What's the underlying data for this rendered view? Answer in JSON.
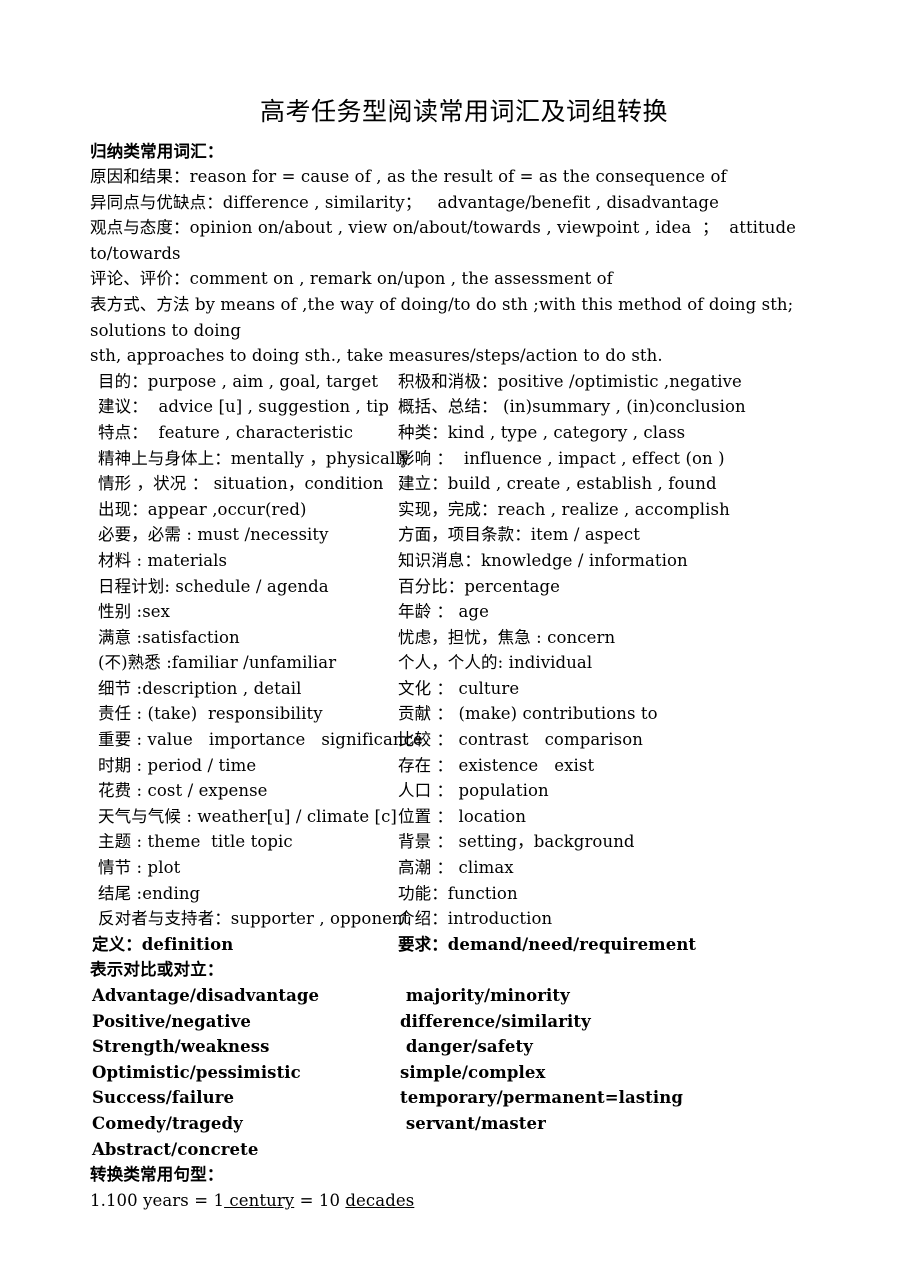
{
  "document": {
    "title": "高考任务型阅读常用词汇及词组转换",
    "section_1_heading": "归纳类常用词汇：",
    "full_lines": [
      "原因和结果：reason for = cause of , as the result of = as the consequence of",
      "异同点与优缺点：difference , similarity；   advantage/benefit , disadvantage",
      "观点与态度：opinion on/about , view on/about/towards , viewpoint , idea  ；  attitude to/towards",
      "评论、评价：comment on , remark on/upon , the assessment of"
    ],
    "method_line_part1": "表方式、方法 by means of ,the way of doing/to do sth ;with this method of doing sth; solutions to doing",
    "method_line_part2": "sth, approaches to doing sth., take measures/steps/action to do sth.",
    "vocab_rows": [
      {
        "left": "目的：purpose , aim , goal, target",
        "right": "积极和消极：positive /optimistic ,negative"
      },
      {
        "left": "建议：  advice [u] , suggestion , tip",
        "right": "概括、总结： (in)summary , (in)conclusion"
      },
      {
        "left": "特点：  feature , characteristic",
        "right": "种类：kind , type , category , class"
      },
      {
        "left": "精神上与身体上：mentally ，physically",
        "right": "影响 ：  influence , impact , effect (on )"
      },
      {
        "left": "情形 ，状况 ： situation，condition",
        "right": "建立：build , create , establish , found"
      },
      {
        "left": "出现：appear ,occur(red)",
        "right": "实现，完成：reach , realize , accomplish"
      },
      {
        "left": "必要，必需 : must /necessity",
        "right": "方面，项目条款：item / aspect"
      },
      {
        "left": "材料 : materials",
        "right": "知识消息：knowledge / information"
      },
      {
        "left": "日程计划: schedule / agenda",
        "right": "百分比：percentage"
      },
      {
        "left": "性别 :sex",
        "right": "年龄 ： age"
      },
      {
        "left": "满意 :satisfaction",
        "right": "忧虑，担忧，焦急 : concern"
      },
      {
        "left": "(不)熟悉 :familiar /unfamiliar",
        "right": "个人，个人的: individual"
      },
      {
        "left": "细节 :description , detail",
        "right": "文化 ： culture"
      },
      {
        "left": "责任 : (take)  responsibility",
        "right": "贡献 ： (make) contributions to"
      },
      {
        "left": "重要 : value   importance   significance",
        "right": "比较 ： contrast   comparison"
      },
      {
        "left": "时期 : period / time",
        "right": "存在 ： existence   exist"
      },
      {
        "left": "花费 : cost / expense",
        "right": "人口 ： population"
      },
      {
        "left": "天气与气候 : weather[u] / climate [c]",
        "right": "位置 ： location"
      },
      {
        "left": "主题 : theme  title topic",
        "right": "背景 ： setting，background"
      },
      {
        "left": "情节 : plot",
        "right": "高潮 ： climax"
      },
      {
        "left": "结尾 :ending",
        "right": "功能：function"
      },
      {
        "left": "反对者与支持者：supporter , opponent",
        "right": "介绍：introduction"
      }
    ],
    "definition_row": {
      "left": "定义：definition",
      "right": "要求：demand/need/requirement"
    },
    "section_2_heading": "表示对比或对立：",
    "contrast_pairs": [
      {
        "left": "Advantage/disadvantage",
        "right": " majority/minority"
      },
      {
        "left": "Positive/negative",
        "right": "difference/similarity"
      },
      {
        "left": "Strength/weakness",
        "right": " danger/safety"
      },
      {
        "left": "Optimistic/pessimistic",
        "right": "simple/complex"
      },
      {
        "left": "Success/failure",
        "right": "temporary/permanent=lasting"
      },
      {
        "left": "Comedy/tragedy",
        "right": " servant/master"
      },
      {
        "left": "Abstract/concrete",
        "right": ""
      }
    ],
    "section_3_heading": "转换类常用句型：",
    "transform_line": {
      "prefix": "1.100 years = 1",
      "underline_1": " century",
      "middle": " = 10 ",
      "underline_2": "decades"
    }
  }
}
